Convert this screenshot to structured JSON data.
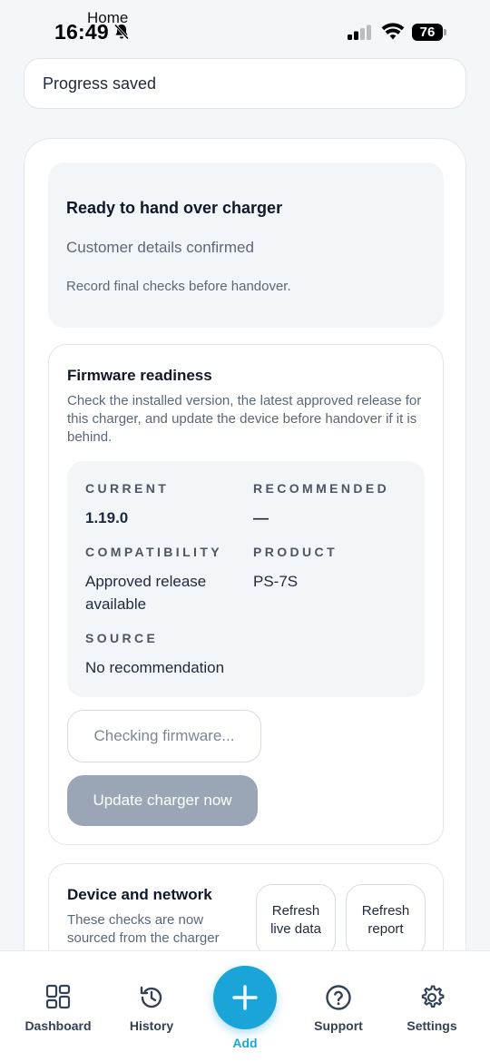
{
  "status_bar": {
    "back_label": "Home",
    "time": "16:49",
    "battery": "76"
  },
  "toast": {
    "text": "Progress saved"
  },
  "ready": {
    "title": "Ready to hand over charger",
    "subtitle": "Customer details confirmed",
    "note": "Record final checks before handover."
  },
  "firmware": {
    "title": "Firmware readiness",
    "description": "Check the installed version, the latest approved release for this charger, and update the device before handover if it is behind.",
    "current_label": "CURRENT",
    "current_value": "1.19.0",
    "recommended_label": "RECOMMENDED",
    "recommended_value": "—",
    "compatibility_label": "COMPATIBILITY",
    "compatibility_value": "Approved release available",
    "product_label": "PRODUCT",
    "product_value": "PS-7S",
    "source_label": "SOURCE",
    "source_value": "No recommendation",
    "checking_label": "Checking firmware...",
    "update_label": "Update charger now"
  },
  "device": {
    "title": "Device and network",
    "description": "These checks are now sourced from the charger",
    "refresh_live_label": "Refresh live data",
    "refresh_report_label": "Refresh report"
  },
  "bottom_nav": {
    "dashboard": "Dashboard",
    "history": "History",
    "add": "Add",
    "support": "Support",
    "settings": "Settings"
  },
  "colors": {
    "accent": "#1aa4d8",
    "disabled_button": "#9aa6b6",
    "panel_bg": "#f3f6f9"
  }
}
